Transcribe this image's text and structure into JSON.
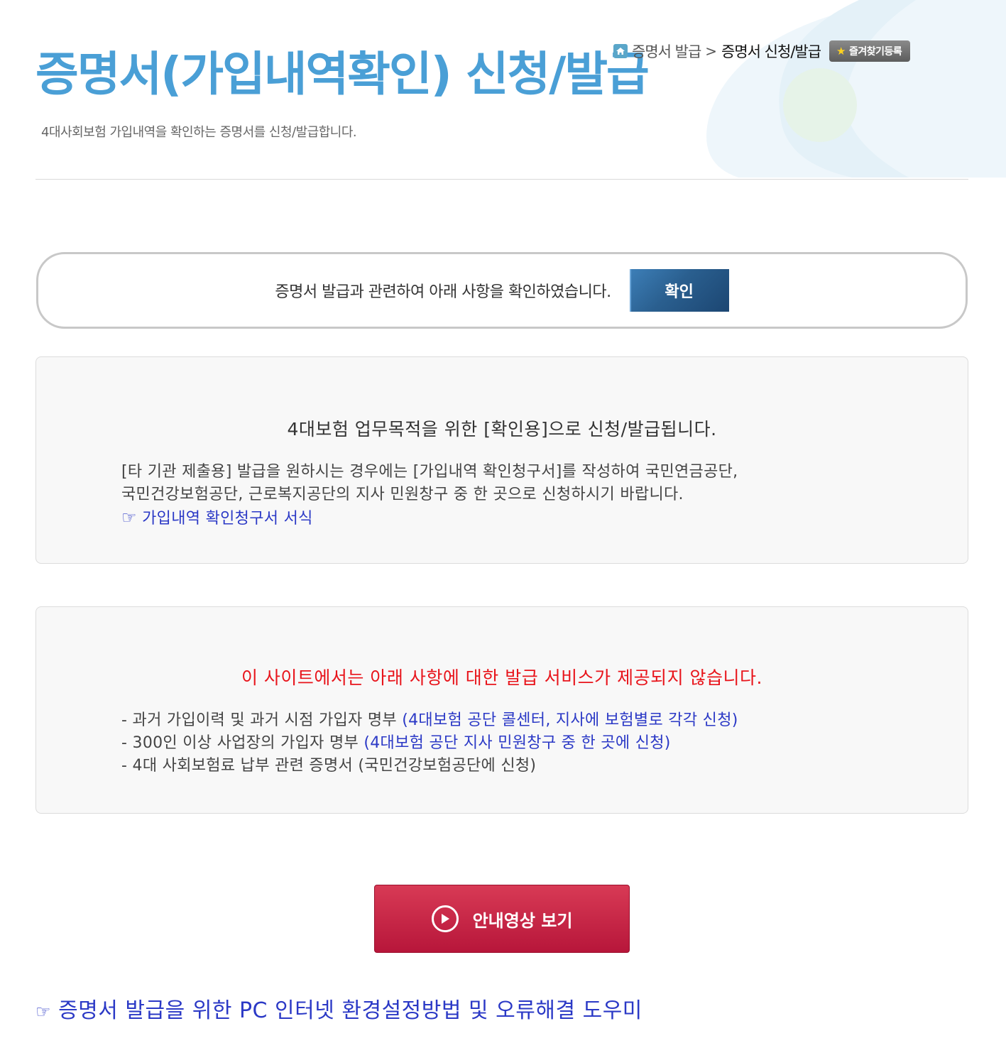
{
  "header": {
    "title": "증명서(가입내역확인) 신청/발급",
    "subtitle": "4대사회보험 가입내역을 확인하는 증명서를 신청/발급합니다."
  },
  "breadcrumb": {
    "home_icon": "home-icon",
    "item": "증명서 발급",
    "separator": ">",
    "current": "증명서 신청/발급",
    "favorite_label": "즐겨찾기등록",
    "favorite_icon": "star-icon"
  },
  "confirm": {
    "text": "증명서 발급과 관련하여 아래 사항을 확인하였습니다.",
    "button_label": "확인"
  },
  "panel1": {
    "heading": "4대보험 업무목적을 위한 [확인용]으로 신청/발급됩니다.",
    "line1": "[타 기관 제출용] 발급을 원하시는 경우에는 [가입내역 확인청구서]를 작성하여 국민연금공단,",
    "line2": "국민건강보험공단, 근로복지공단의 지사 민원창구 중 한 곳으로 신청하시기 바랍니다.",
    "link_icon": "☞",
    "link_text": "가입내역 확인청구서 서식"
  },
  "panel2": {
    "heading": "이 사이트에서는 아래 사항에 대한 발급 서비스가 제공되지 않습니다.",
    "items": [
      {
        "text": "- 과거 가입이력 및 과거 시점 가입자 명부 ",
        "note": "(4대보험 공단 콜센터, 지사에 보험별로 각각 신청)"
      },
      {
        "text": "- 300인 이상 사업장의 가입자 명부 ",
        "note": "(4대보험 공단 지사 민원창구 중 한 곳에 신청)"
      },
      {
        "text": "- 4대 사회보험료 납부 관련 증명서 (국민건강보험공단에 신청)",
        "note": ""
      }
    ]
  },
  "video": {
    "label": "안내영상 보기",
    "icon": "play-icon"
  },
  "help": {
    "icon": "☞",
    "text": "증명서 발급을 위한 PC 인터넷 환경설정방법 및 오류해결 도우미"
  },
  "colors": {
    "title_blue": "#4a9fd6",
    "warning_red": "#e8141b",
    "link_blue": "#2b39c6",
    "button_navy": "#2a5f8f",
    "video_red": "#c5213f"
  }
}
